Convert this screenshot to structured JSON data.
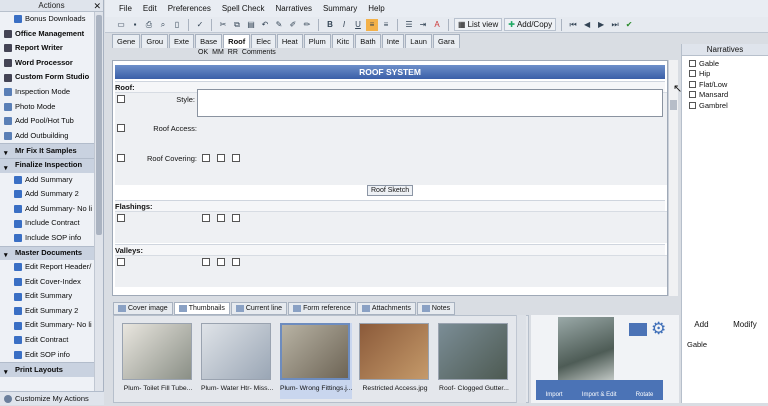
{
  "actions_panel": {
    "title": "Actions",
    "items": [
      {
        "label": "Bonus Downloads",
        "kind": "sub"
      },
      {
        "label": "Office Management",
        "kind": "bold"
      },
      {
        "label": "Report Writer",
        "kind": "bold"
      },
      {
        "label": "Word Processor",
        "kind": "bold"
      },
      {
        "label": "Custom Form Studio",
        "kind": "bold"
      },
      {
        "label": "Inspection Mode",
        "kind": "item"
      },
      {
        "label": "Photo Mode",
        "kind": "item"
      },
      {
        "label": "Add Pool/Hot Tub",
        "kind": "item"
      },
      {
        "label": "Add Outbuilding",
        "kind": "item"
      },
      {
        "label": "Mr Fix It Samples",
        "kind": "group"
      },
      {
        "label": "Finalize Inspection",
        "kind": "group"
      },
      {
        "label": "Add Summary",
        "kind": "sub"
      },
      {
        "label": "Add Summary 2",
        "kind": "sub"
      },
      {
        "label": "Add Summary- No li",
        "kind": "sub"
      },
      {
        "label": "Include Contract",
        "kind": "sub"
      },
      {
        "label": "Include SOP info",
        "kind": "sub"
      },
      {
        "label": "Master Documents",
        "kind": "group"
      },
      {
        "label": "Edit Report Header/",
        "kind": "sub"
      },
      {
        "label": "Edit Cover-Index",
        "kind": "sub"
      },
      {
        "label": "Edit Summary",
        "kind": "sub"
      },
      {
        "label": "Edit Summary 2",
        "kind": "sub"
      },
      {
        "label": "Edit Summary- No li",
        "kind": "sub"
      },
      {
        "label": "Edit Contract",
        "kind": "sub"
      },
      {
        "label": "Edit SOP info",
        "kind": "sub"
      },
      {
        "label": "Print Layouts",
        "kind": "group"
      }
    ],
    "customize_label": "Customize My Actions"
  },
  "menu": [
    "File",
    "Edit",
    "Preferences",
    "Spell Check",
    "Narratives",
    "Summary",
    "Help"
  ],
  "toolbar": {
    "list_view": "List view",
    "add_copy": "Add/Copy",
    "bold": "B",
    "italic": "I",
    "underline": "U"
  },
  "section_tabs": [
    "Gene",
    "Grou",
    "Exte",
    "Base",
    "Roof",
    "Elec",
    "Heat",
    "Plum",
    "Kitc",
    "Bath",
    "Inte",
    "Laun",
    "Gara"
  ],
  "active_section": "Roof",
  "column_headers": [
    "OK",
    "MM",
    "RR",
    "Comments"
  ],
  "form": {
    "title": "ROOF SYSTEM",
    "roof_header": "Roof:",
    "style_label": "Style:",
    "roof_access_label": "Roof Access:",
    "roof_covering_label": "Roof Covering:",
    "roof_sketch_button": "Roof Sketch",
    "flashings_header": "Flashings:",
    "valleys_header": "Valleys:"
  },
  "bottom_tabs": [
    "Cover image",
    "Thumbnails",
    "Current line",
    "Form reference",
    "Attachments",
    "Notes"
  ],
  "active_bottom_tab": "Thumbnails",
  "thumbnails": [
    {
      "caption": "Plum- Toilet Fill Tube...",
      "colors": [
        "#e9e6df",
        "#8a8f86"
      ]
    },
    {
      "caption": "Plum- Water Htr- Miss...",
      "colors": [
        "#dfe3e8",
        "#9aa6b5"
      ]
    },
    {
      "caption": "Plum- Wrong Fittings.j...",
      "colors": [
        "#b8b3a4",
        "#6d6455"
      ],
      "selected": true
    },
    {
      "caption": "Restricted Access.jpg",
      "colors": [
        "#8b5a3a",
        "#c59a6a"
      ]
    },
    {
      "caption": "Roof- Clogged Gutter...",
      "colors": [
        "#7b8d96",
        "#4d5a52"
      ]
    }
  ],
  "preview_buttons": [
    "Import",
    "Import & Edit",
    "Rotate"
  ],
  "narratives": {
    "title": "Narratives",
    "items": [
      "Gable",
      "Hip",
      "Flat/Low",
      "Mansard",
      "Gambrel"
    ],
    "add_label": "Add",
    "modify_label": "Modify",
    "selected_text": "Gable"
  },
  "colors": {
    "accent": "#3a5fa8",
    "header_gradient_top": "#6d8fc9"
  }
}
